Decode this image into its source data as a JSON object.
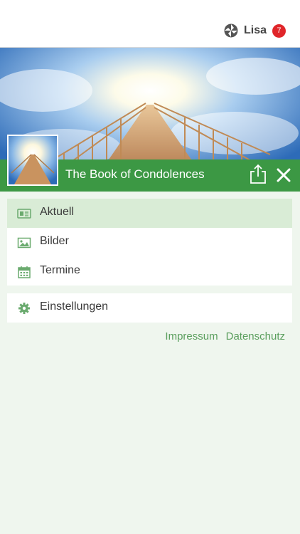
{
  "header": {
    "user_name": "Lisa",
    "notification_count": "7",
    "brand_icon": "app-logo-icon"
  },
  "hero": {
    "image": "sky-bridge-photo",
    "title": "The Book of Condolences",
    "share_icon": "share-icon",
    "close_icon": "close-icon"
  },
  "menu": {
    "items": [
      {
        "label": "Aktuell",
        "icon": "newspaper-icon",
        "active": true
      },
      {
        "label": "Bilder",
        "icon": "image-icon",
        "active": false
      },
      {
        "label": "Termine",
        "icon": "calendar-icon",
        "active": false
      }
    ]
  },
  "settings": {
    "label": "Einstellungen",
    "icon": "gear-icon"
  },
  "footer": {
    "impressum": "Impressum",
    "datenschutz": "Datenschutz"
  },
  "colors": {
    "accent": "#3c9844",
    "active_bg": "#d9ecd6",
    "page_bg": "#eff6ee",
    "link": "#5a9e5d",
    "icon": "#6aaa6e",
    "badge": "#e0262a"
  }
}
